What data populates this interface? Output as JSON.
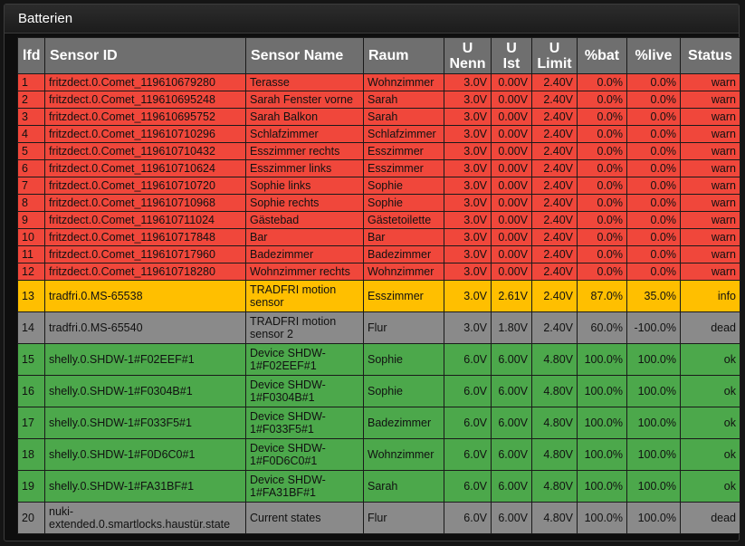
{
  "panel": {
    "title": "Batterien"
  },
  "columns": [
    "lfd",
    "Sensor ID",
    "Sensor Name",
    "Raum",
    "U\nNenn",
    "U\nIst",
    "U\nLimit",
    "%bat",
    "%live",
    "Status"
  ],
  "rows": [
    {
      "lfd": "1",
      "id": "fritzdect.0.Comet_119610679280",
      "name": "Terasse",
      "raum": "Wohnzimmer",
      "nenn": "3.0V",
      "ist": "0.00V",
      "limit": "2.40V",
      "bat": "0.0%",
      "live": "0.0%",
      "status": "warn"
    },
    {
      "lfd": "2",
      "id": "fritzdect.0.Comet_119610695248",
      "name": "Sarah Fenster vorne",
      "raum": "Sarah",
      "nenn": "3.0V",
      "ist": "0.00V",
      "limit": "2.40V",
      "bat": "0.0%",
      "live": "0.0%",
      "status": "warn"
    },
    {
      "lfd": "3",
      "id": "fritzdect.0.Comet_119610695752",
      "name": "Sarah Balkon",
      "raum": "Sarah",
      "nenn": "3.0V",
      "ist": "0.00V",
      "limit": "2.40V",
      "bat": "0.0%",
      "live": "0.0%",
      "status": "warn"
    },
    {
      "lfd": "4",
      "id": "fritzdect.0.Comet_119610710296",
      "name": "Schlafzimmer",
      "raum": "Schlafzimmer",
      "nenn": "3.0V",
      "ist": "0.00V",
      "limit": "2.40V",
      "bat": "0.0%",
      "live": "0.0%",
      "status": "warn"
    },
    {
      "lfd": "5",
      "id": "fritzdect.0.Comet_119610710432",
      "name": "Esszimmer rechts",
      "raum": "Esszimmer",
      "nenn": "3.0V",
      "ist": "0.00V",
      "limit": "2.40V",
      "bat": "0.0%",
      "live": "0.0%",
      "status": "warn"
    },
    {
      "lfd": "6",
      "id": "fritzdect.0.Comet_119610710624",
      "name": "Esszimmer links",
      "raum": "Esszimmer",
      "nenn": "3.0V",
      "ist": "0.00V",
      "limit": "2.40V",
      "bat": "0.0%",
      "live": "0.0%",
      "status": "warn"
    },
    {
      "lfd": "7",
      "id": "fritzdect.0.Comet_119610710720",
      "name": "Sophie links",
      "raum": "Sophie",
      "nenn": "3.0V",
      "ist": "0.00V",
      "limit": "2.40V",
      "bat": "0.0%",
      "live": "0.0%",
      "status": "warn"
    },
    {
      "lfd": "8",
      "id": "fritzdect.0.Comet_119610710968",
      "name": "Sophie rechts",
      "raum": "Sophie",
      "nenn": "3.0V",
      "ist": "0.00V",
      "limit": "2.40V",
      "bat": "0.0%",
      "live": "0.0%",
      "status": "warn"
    },
    {
      "lfd": "9",
      "id": "fritzdect.0.Comet_119610711024",
      "name": "Gästebad",
      "raum": "Gästetoilette",
      "nenn": "3.0V",
      "ist": "0.00V",
      "limit": "2.40V",
      "bat": "0.0%",
      "live": "0.0%",
      "status": "warn"
    },
    {
      "lfd": "10",
      "id": "fritzdect.0.Comet_119610717848",
      "name": "Bar",
      "raum": "Bar",
      "nenn": "3.0V",
      "ist": "0.00V",
      "limit": "2.40V",
      "bat": "0.0%",
      "live": "0.0%",
      "status": "warn"
    },
    {
      "lfd": "11",
      "id": "fritzdect.0.Comet_119610717960",
      "name": "Badezimmer",
      "raum": "Badezimmer",
      "nenn": "3.0V",
      "ist": "0.00V",
      "limit": "2.40V",
      "bat": "0.0%",
      "live": "0.0%",
      "status": "warn"
    },
    {
      "lfd": "12",
      "id": "fritzdect.0.Comet_119610718280",
      "name": "Wohnzimmer rechts",
      "raum": "Wohnzimmer",
      "nenn": "3.0V",
      "ist": "0.00V",
      "limit": "2.40V",
      "bat": "0.0%",
      "live": "0.0%",
      "status": "warn"
    },
    {
      "lfd": "13",
      "id": "tradfri.0.MS-65538",
      "name": "TRADFRI motion sensor",
      "raum": "Esszimmer",
      "nenn": "3.0V",
      "ist": "2.61V",
      "limit": "2.40V",
      "bat": "87.0%",
      "live": "35.0%",
      "status": "info"
    },
    {
      "lfd": "14",
      "id": "tradfri.0.MS-65540",
      "name": "TRADFRI motion sensor 2",
      "raum": "Flur",
      "nenn": "3.0V",
      "ist": "1.80V",
      "limit": "2.40V",
      "bat": "60.0%",
      "live": "-100.0%",
      "status": "dead"
    },
    {
      "lfd": "15",
      "id": "shelly.0.SHDW-1#F02EEF#1",
      "name": "Device SHDW-1#F02EEF#1",
      "raum": "Sophie",
      "nenn": "6.0V",
      "ist": "6.00V",
      "limit": "4.80V",
      "bat": "100.0%",
      "live": "100.0%",
      "status": "ok"
    },
    {
      "lfd": "16",
      "id": "shelly.0.SHDW-1#F0304B#1",
      "name": "Device SHDW-1#F0304B#1",
      "raum": "Sophie",
      "nenn": "6.0V",
      "ist": "6.00V",
      "limit": "4.80V",
      "bat": "100.0%",
      "live": "100.0%",
      "status": "ok"
    },
    {
      "lfd": "17",
      "id": "shelly.0.SHDW-1#F033F5#1",
      "name": "Device SHDW-1#F033F5#1",
      "raum": "Badezimmer",
      "nenn": "6.0V",
      "ist": "6.00V",
      "limit": "4.80V",
      "bat": "100.0%",
      "live": "100.0%",
      "status": "ok"
    },
    {
      "lfd": "18",
      "id": "shelly.0.SHDW-1#F0D6C0#1",
      "name": "Device SHDW-1#F0D6C0#1",
      "raum": "Wohnzimmer",
      "nenn": "6.0V",
      "ist": "6.00V",
      "limit": "4.80V",
      "bat": "100.0%",
      "live": "100.0%",
      "status": "ok"
    },
    {
      "lfd": "19",
      "id": "shelly.0.SHDW-1#FA31BF#1",
      "name": "Device SHDW-1#FA31BF#1",
      "raum": "Sarah",
      "nenn": "6.0V",
      "ist": "6.00V",
      "limit": "4.80V",
      "bat": "100.0%",
      "live": "100.0%",
      "status": "ok"
    },
    {
      "lfd": "20",
      "id": "nuki-extended.0.smartlocks.haustür.state",
      "name": "Current states",
      "raum": "Flur",
      "nenn": "6.0V",
      "ist": "6.00V",
      "limit": "4.80V",
      "bat": "100.0%",
      "live": "100.0%",
      "status": "dead"
    }
  ],
  "colors": {
    "warn": "#f0473b",
    "info": "#ffbf00",
    "dead": "#8a8a8a",
    "ok": "#4ca84b",
    "header": "#6f6f6f"
  }
}
